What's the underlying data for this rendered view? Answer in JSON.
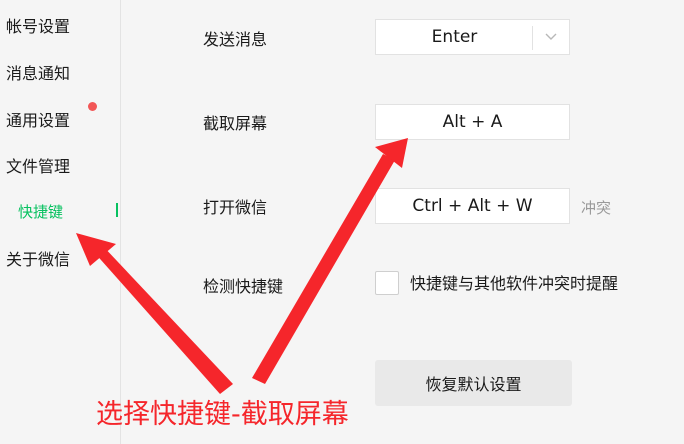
{
  "sidebar": {
    "items": [
      {
        "label": "帐号设置"
      },
      {
        "label": "消息通知"
      },
      {
        "label": "通用设置",
        "has_badge": true
      },
      {
        "label": "文件管理"
      },
      {
        "label": "快捷键",
        "active": true
      },
      {
        "label": "关于微信"
      }
    ]
  },
  "shortcuts": {
    "send": {
      "label": "发送消息",
      "value": "Enter"
    },
    "screenshot": {
      "label": "截取屏幕",
      "value": "Alt + A"
    },
    "open_wechat": {
      "label": "打开微信",
      "value": "Ctrl + Alt + W",
      "status": "冲突"
    },
    "detect": {
      "label": "检测快捷键",
      "checkbox_label": "快捷键与其他软件冲突时提醒",
      "checked": false
    },
    "restore_label": "恢复默认设置"
  },
  "annotation": {
    "caption": "选择快捷键-截取屏幕",
    "color": "#f5262b"
  },
  "colors": {
    "accent": "#07c160",
    "badge": "#f25656",
    "background": "#f5f5f5"
  }
}
